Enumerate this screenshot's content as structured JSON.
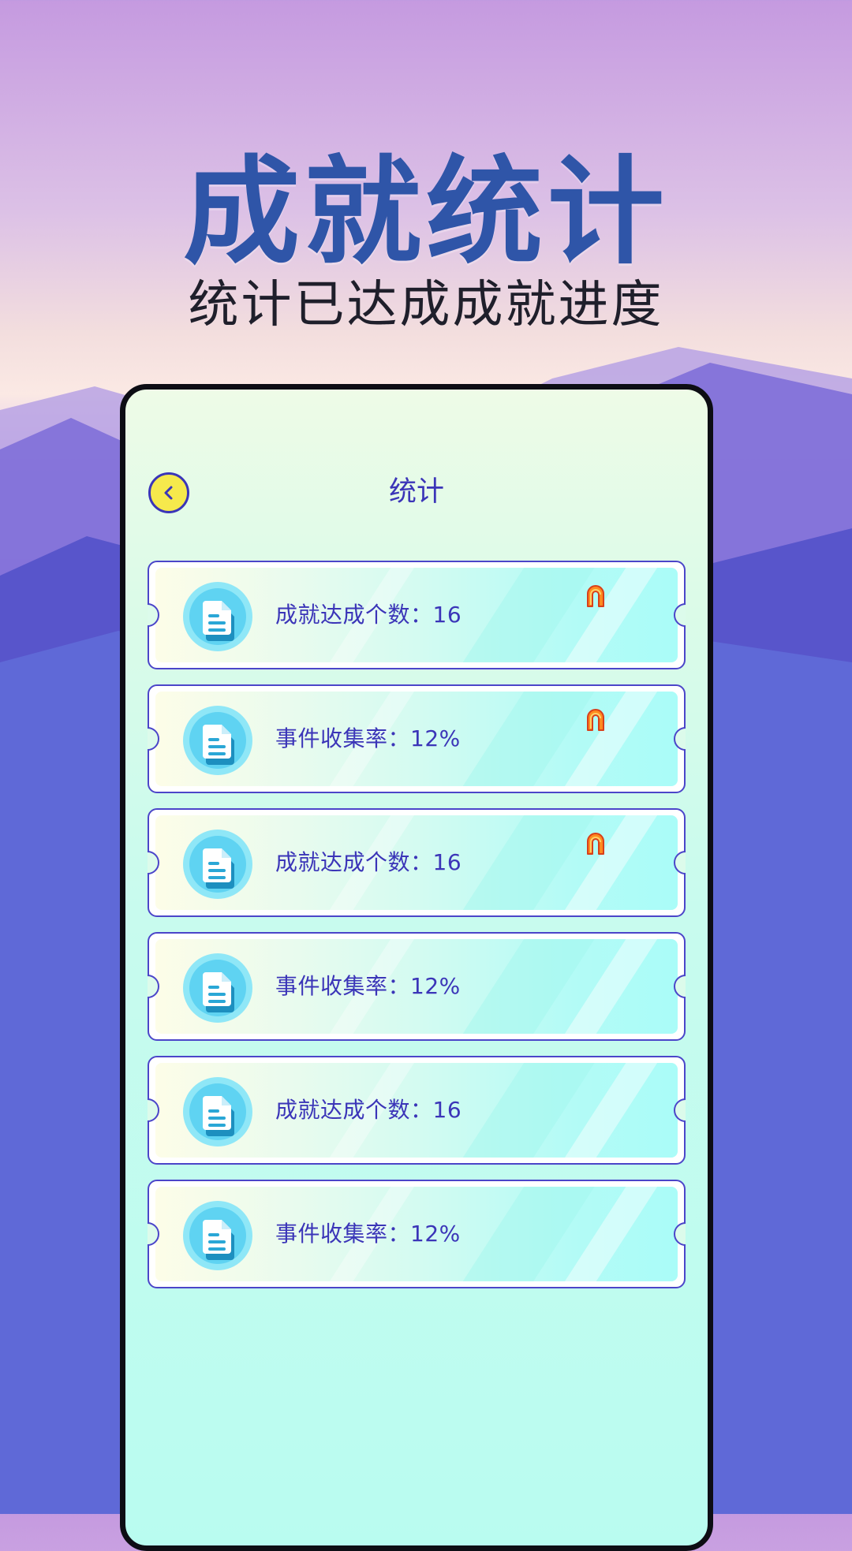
{
  "header": {
    "title": "成就统计",
    "subtitle": "统计已达成成就进度"
  },
  "screen": {
    "nav": {
      "back_icon": "chevron-left-icon",
      "title": "统计"
    },
    "stats": [
      {
        "label": "成就达成个数：16",
        "icon": "document-icon",
        "badge": "medal-ribbon-icon"
      },
      {
        "label": "事件收集率：12%",
        "icon": "document-icon",
        "badge": "medal-ribbon-icon"
      },
      {
        "label": "成就达成个数：16",
        "icon": "document-icon",
        "badge": "medal-ribbon-icon"
      },
      {
        "label": "事件收集率：12%",
        "icon": "document-icon",
        "badge": null
      },
      {
        "label": "成就达成个数：16",
        "icon": "document-icon",
        "badge": null
      },
      {
        "label": "事件收集率：12%",
        "icon": "document-icon",
        "badge": null
      }
    ]
  },
  "colors": {
    "title_blue": "#2f55a8",
    "accent_indigo": "#3b35b8",
    "back_button_yellow": "#f6e94c",
    "badge_orange": "#ff7a1a"
  }
}
